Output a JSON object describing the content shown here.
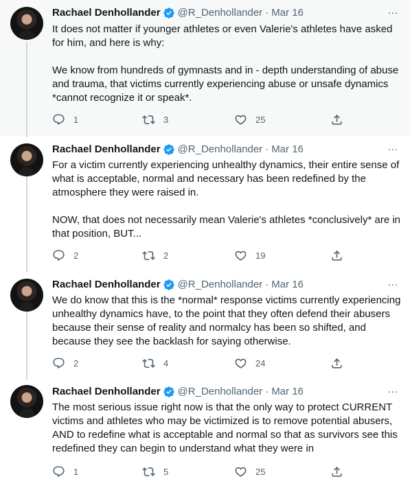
{
  "author": {
    "name": "Rachael Denhollander",
    "handle": "@R_Denhollander",
    "separator": "·",
    "date": "Mar 16"
  },
  "more_glyph": "···",
  "tweets": [
    {
      "text": "It does not matter if younger athletes or even Valerie's athletes have asked for him, and here is why:\n\nWe know from hundreds of gymnasts and in - depth understanding of abuse and trauma, that victims currently experiencing abuse or unsafe dynamics *cannot recognize it or speak*.",
      "replies": "1",
      "retweets": "3",
      "likes": "25"
    },
    {
      "text": "For a victim currently experiencing unhealthy dynamics, their entire sense of what is acceptable, normal and necessary has been redefined by the atmosphere they were raised in.\n\nNOW, that does not necessarily mean Valerie's athletes *conclusively* are in that position, BUT...",
      "replies": "2",
      "retweets": "2",
      "likes": "19"
    },
    {
      "text": "We do know that this is the *normal* response victims currently experiencing unhealthy dynamics have, to the point that they often defend their abusers because their sense of reality and normalcy has been so shifted, and because they see the backlash for saying otherwise.",
      "replies": "2",
      "retweets": "4",
      "likes": "24"
    },
    {
      "text": "The most serious issue right now is that the only way to protect CURRENT victims and athletes who may be victimized is to remove potential abusers, AND to redefine what is acceptable and normal so that as survivors see this redefined they can begin to understand what they were in",
      "replies": "1",
      "retweets": "5",
      "likes": "25"
    }
  ],
  "colors": {
    "text": "#0f1419",
    "secondary": "#536471",
    "verified": "#1d9bf0",
    "thread_line": "#cfd9de",
    "highlight_bg": "#f7f9f9"
  },
  "icons": [
    "verified-badge-icon",
    "more-icon",
    "reply-icon",
    "retweet-icon",
    "like-icon",
    "share-icon"
  ]
}
